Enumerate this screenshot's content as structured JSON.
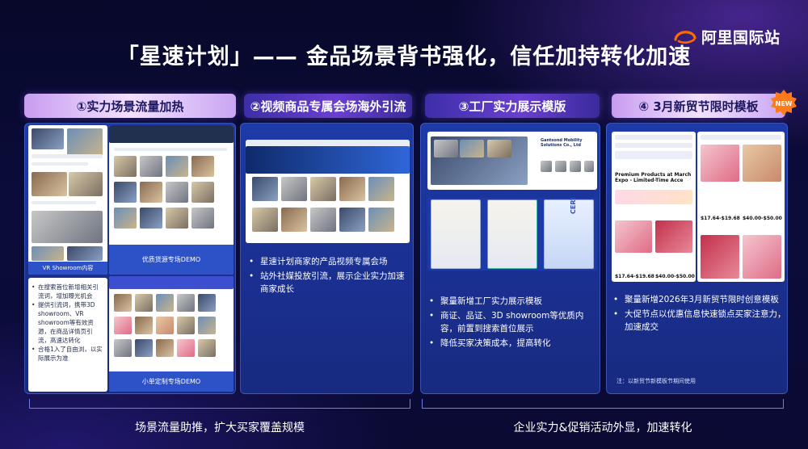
{
  "brand": {
    "name": "阿里国际站"
  },
  "title": "「星速计划」—— 金品场景背书强化，信任加持转化加速",
  "sections": [
    {
      "header": "①实力场景流量加热",
      "shot_captions": [
        "VR Showroom内容",
        "优质货源专场DEMO",
        "小单定制专场DEMO"
      ],
      "mini_bullets": [
        "在搜索首位新增相关引流词，增加曝光机会",
        "提供引流词，携带3D showroom、VR showroom等有效资源，在商品详情页引流，高速达转化",
        "合格1入了自由浏，以实际展示为准"
      ]
    },
    {
      "header": "②视频商品专属会场海外引流",
      "bullets": [
        "星速计划商家的产品视频专属会场",
        "站外社媒投放引流，展示企业实力加速商家成长"
      ]
    },
    {
      "header": "③工厂实力展示模版",
      "bullets": [
        "聚量新增工厂实力展示模板",
        "商证、品证、3D showroom等优质内容，前置到搜索首位展示",
        "降低买家决策成本，提高转化"
      ]
    },
    {
      "header": "④ 3月新贸节限时模板",
      "badge": "NEW",
      "bullets": [
        "聚量新增2026年3月新贸节限时创意模板",
        "大促节点以优惠信息快速锁点买家注意力，加速成交"
      ],
      "note": "注：以新贸节新模板节期间使用"
    }
  ],
  "footer": {
    "left": "场景流量助推，扩大买家覆盖规模",
    "right": "企业实力&促销活动外显，加速转化"
  },
  "shot_labels": {
    "s3_company": "Gantsond Mobility Solutions Co., Ltd",
    "s3_cert_text": "CERTIFICATE",
    "s4_promo": "Premium Products at March Expo - Limited-Time Acce",
    "s4_price1": "$17.64-$19.68",
    "s4_price2": "$40.00-$50.00",
    "s4_price3": "$17.64-$19.68",
    "s4_price4": "$40.00-$50.00"
  },
  "colors": {
    "bg": "#0b0c3a",
    "panel": "#1d3aa8",
    "header": "#6a3fd1",
    "header_light": "#f3e1ff",
    "badge": "#ff7a1a"
  }
}
